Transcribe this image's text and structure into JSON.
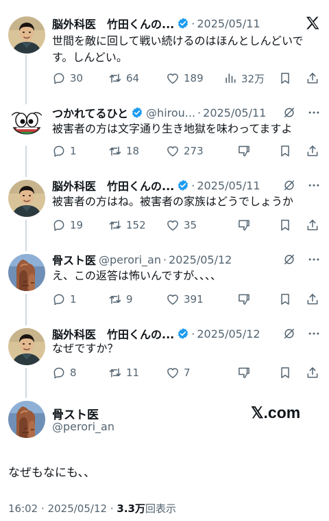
{
  "posts": [
    {
      "name": "脳外科医　竹田くんの...",
      "handle": "",
      "date": "2025/05/11",
      "text": "世間を敵に回して戦い続けるのはほんとしんどいです。しんどい。",
      "replies": "30",
      "reposts": "64",
      "likes": "189",
      "views": "32万"
    },
    {
      "name": "つかれてるひと",
      "handle": "@hirou...",
      "date": "2025/05/11",
      "text": "被害者の方は文字通り生き地獄を味わってますよ",
      "replies": "1",
      "reposts": "18",
      "likes": "273"
    },
    {
      "name": "脳外科医　竹田くんの...",
      "handle": "",
      "date": "2025/05/11",
      "text": "被害者の方はね。被害者の家族はどうでしょうか",
      "replies": "19",
      "reposts": "152",
      "likes": "35"
    },
    {
      "name": "骨スト医",
      "handle": "@perori_an",
      "date": "2025/05/12",
      "text": "え、この返答は怖いんですが、、、、",
      "replies": "1",
      "reposts": "9",
      "likes": "391"
    },
    {
      "name": "脳外科医　竹田くんの...",
      "handle": "",
      "date": "2025/05/12",
      "text": "なぜですか？",
      "replies": "8",
      "reposts": "11",
      "likes": "7"
    }
  ],
  "main_post": {
    "name": "骨スト医",
    "handle": "@perori_an",
    "watermark": "𝕏.com",
    "text": "なぜもなにも、、",
    "time": "16:02",
    "date": "2025/05/12",
    "views_count": "3.3万",
    "views_label": "回表示"
  },
  "separator": "·",
  "colors": {
    "text": "#0f1419",
    "muted": "#536471",
    "verified": "#1d9bf0",
    "line": "#cfd9de"
  },
  "icons": [
    "reply-icon",
    "repost-icon",
    "like-icon",
    "views-icon",
    "bookmark-icon",
    "share-icon",
    "dislike-icon",
    "not-interested-icon",
    "more-icon",
    "x-logo-icon",
    "verified-badge-icon"
  ]
}
